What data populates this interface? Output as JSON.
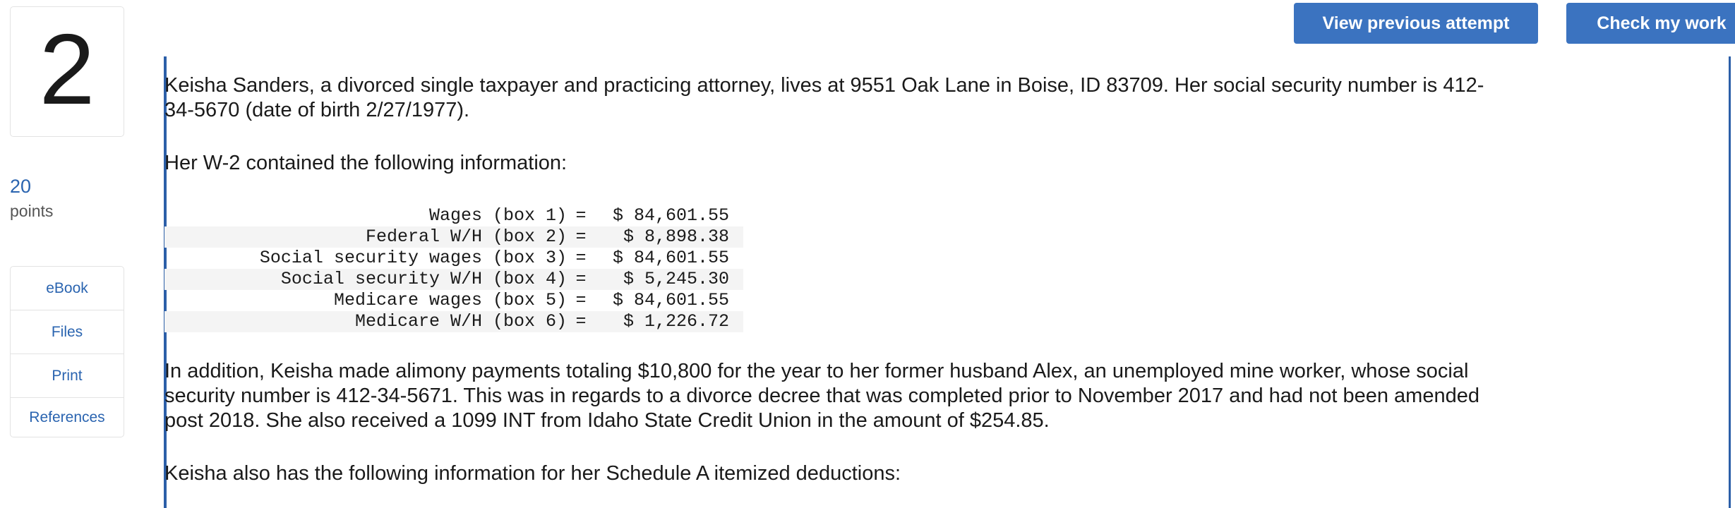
{
  "question": {
    "number": "2",
    "points_value": "20",
    "points_label": "points"
  },
  "tools": [
    {
      "label": "eBook"
    },
    {
      "label": "Files"
    },
    {
      "label": "Print"
    },
    {
      "label": "References"
    }
  ],
  "header": {
    "view_previous_label": "View previous attempt",
    "check_work_label": "Check my work"
  },
  "content": {
    "para1": "Keisha Sanders, a divorced single taxpayer and practicing attorney, lives at 9551 Oak Lane in Boise, ID 83709. Her social security number is 412-34-5670 (date of birth 2/27/1977).",
    "para2": "Her W-2 contained the following information:",
    "w2_rows": [
      {
        "label": "Wages (box 1)",
        "eq": "=",
        "value": "$ 84,601.55"
      },
      {
        "label": "Federal W/H (box 2)",
        "eq": "=",
        "value": "$ 8,898.38"
      },
      {
        "label": "Social security wages (box 3)",
        "eq": "=",
        "value": "$ 84,601.55"
      },
      {
        "label": "Social security W/H (box 4)",
        "eq": "=",
        "value": "$ 5,245.30"
      },
      {
        "label": "Medicare wages (box 5)",
        "eq": "=",
        "value": "$ 84,601.55"
      },
      {
        "label": "Medicare W/H (box 6)",
        "eq": "=",
        "value": "$ 1,226.72"
      }
    ],
    "para3": "In addition, Keisha made alimony payments totaling $10,800 for the year to her former husband Alex, an unemployed mine worker, whose social security number is 412-34-5671. This was in regards to a divorce decree that was completed prior to November 2017 and had not been amended post 2018. She also received a 1099 INT from Idaho State Credit Union in the amount of $254.85.",
    "para4": "Keisha also has the following information for her Schedule A itemized deductions:"
  },
  "colors": {
    "accent": "#3b73c0",
    "link": "#2a64b0",
    "border_bar": "#2c5fa8"
  }
}
